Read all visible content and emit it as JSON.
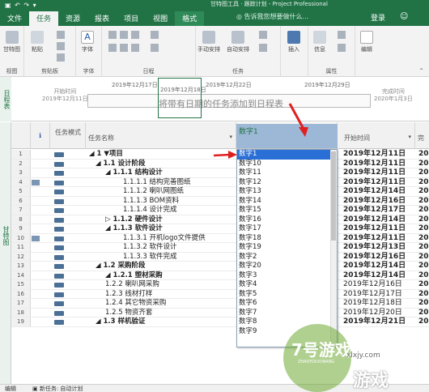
{
  "app": {
    "title": "甘特图工具 · 跟踪计划 - Project Professional",
    "tabs": [
      "文件",
      "任务",
      "资源",
      "报表",
      "项目",
      "视图",
      "格式"
    ],
    "active_tab": "任务",
    "search_placeholder": "告诉我您想要做什么...",
    "login_label": "登录",
    "accent": "#217346"
  },
  "ribbon": {
    "groups": [
      {
        "label": "视图",
        "buttons": [
          "甘特图"
        ]
      },
      {
        "label": "剪贴板",
        "buttons": [
          "粘贴"
        ]
      },
      {
        "label": "字体",
        "buttons": [
          "字体"
        ]
      },
      {
        "label": "日程",
        "buttons": []
      },
      {
        "label": "任务",
        "buttons": [
          "手动安排",
          "自动安排",
          "任务"
        ]
      },
      {
        "label": "插入",
        "buttons": [
          "插入"
        ]
      },
      {
        "label": "属性",
        "buttons": [
          "信息"
        ]
      },
      {
        "label": "编辑",
        "buttons": [
          "编辑"
        ]
      }
    ]
  },
  "timeline": {
    "side_label": "日程表",
    "start_label": "开始时间",
    "start_date": "2019年12月11日",
    "end_label": "完成时间",
    "end_date": "2020年1月3日",
    "dates": [
      "2019年12月17日",
      "2019年12月18日",
      "2019年12月22日",
      "2019年12月29日"
    ],
    "placeholder": "将带有日期的任务添加到日程表"
  },
  "grid": {
    "side_label": "甘特图",
    "headers": {
      "info": "ℹ",
      "mode": "任务模式",
      "name": "任务名称",
      "new_column": "数字1",
      "start": "开始时间",
      "finish": "完"
    },
    "rows": [
      {
        "num": "1",
        "name": "◢ 1 ▼项目",
        "level": 0,
        "bold": true,
        "start": "2019年12月11日",
        "next": "20",
        "start_bold": true,
        "info": false
      },
      {
        "num": "2",
        "name": "◢ 1.1 设计阶段",
        "level": 1,
        "bold": true,
        "start": "2019年12月11日",
        "next": "20",
        "start_bold": true,
        "info": false
      },
      {
        "num": "3",
        "name": "◢ 1.1.1 结构设计",
        "level": 2,
        "bold": true,
        "start": "2019年12月11日",
        "next": "20",
        "start_bold": true,
        "info": false
      },
      {
        "num": "4",
        "name": "1.1.1.1 结构完善图纸",
        "level": 3,
        "bold": false,
        "start": "2019年12月11日",
        "next": "20",
        "start_bold": true,
        "info": true
      },
      {
        "num": "5",
        "name": "1.1.1.2 喇叭网图纸",
        "level": 3,
        "bold": false,
        "start": "2019年12月14日",
        "next": "20",
        "start_bold": true,
        "info": false
      },
      {
        "num": "6",
        "name": "1.1.1.3 BOM资料",
        "level": 3,
        "bold": false,
        "start": "2019年12月16日",
        "next": "20",
        "start_bold": true,
        "info": false
      },
      {
        "num": "7",
        "name": "1.1.1.4 设计完成",
        "level": 3,
        "bold": false,
        "start": "2019年12月17日",
        "next": "20",
        "start_bold": true,
        "info": false
      },
      {
        "num": "8",
        "name": "▷ 1.1.2 硬件设计",
        "level": 2,
        "bold": true,
        "start": "2019年12月14日",
        "next": "20",
        "start_bold": true,
        "info": false
      },
      {
        "num": "9",
        "name": "◢ 1.1.3 软件设计",
        "level": 2,
        "bold": true,
        "start": "2019年12月11日",
        "next": "20",
        "start_bold": true,
        "info": false
      },
      {
        "num": "10",
        "name": "1.1.3.1 开机logo文件提供",
        "level": 3,
        "bold": false,
        "start": "2019年12月11日",
        "next": "20",
        "start_bold": true,
        "info": true
      },
      {
        "num": "11",
        "name": "1.1.3.2 软件设计",
        "level": 3,
        "bold": false,
        "start": "2019年12月13日",
        "next": "20",
        "start_bold": true,
        "info": false
      },
      {
        "num": "12",
        "name": "1.1.3.3 软件完成",
        "level": 3,
        "bold": false,
        "start": "2019年12月16日",
        "next": "20",
        "start_bold": true,
        "info": false
      },
      {
        "num": "13",
        "name": "◢ 1.2 采购阶段",
        "level": 1,
        "bold": true,
        "start": "2019年12月14日",
        "next": "20",
        "start_bold": true,
        "info": false
      },
      {
        "num": "14",
        "name": "◢ 1.2.1 塑材采购",
        "level": 2,
        "bold": true,
        "start": "2019年12月14日",
        "next": "20",
        "start_bold": true,
        "info": false
      },
      {
        "num": "15",
        "name": "1.2.2 喇叭网采购",
        "level": 2,
        "bold": false,
        "start": "2019年12月16日",
        "next": "20",
        "start_bold": false,
        "info": false
      },
      {
        "num": "16",
        "name": "1.2.3 线材打样",
        "level": 2,
        "bold": false,
        "start": "2019年12月17日",
        "next": "20",
        "start_bold": false,
        "info": false
      },
      {
        "num": "17",
        "name": "1.2.4 其它物资采购",
        "level": 2,
        "bold": false,
        "start": "2019年12月18日",
        "next": "20",
        "start_bold": false,
        "info": false
      },
      {
        "num": "18",
        "name": "1.2.5 物资齐套",
        "level": 2,
        "bold": false,
        "start": "2019年12月20日",
        "next": "20",
        "start_bold": false,
        "info": false
      },
      {
        "num": "19",
        "name": "◢ 1.3 样机验证",
        "level": 1,
        "bold": true,
        "start": "2019年12月21日",
        "next": "20",
        "start_bold": true,
        "info": false
      }
    ]
  },
  "dropdown": {
    "selected": "数字1",
    "items": [
      "数字1",
      "数字10",
      "数字11",
      "数字12",
      "数字13",
      "数字14",
      "数字15",
      "数字16",
      "数字17",
      "数字18",
      "数字19",
      "数字2",
      "数字20",
      "数字3",
      "数字4",
      "数字5",
      "数字6",
      "数字7",
      "数字8",
      "数字9"
    ]
  },
  "status_bar": {
    "mode": "编辑",
    "new_task": "新任务: 自动计划"
  },
  "watermark": {
    "brand": "7号游戏网",
    "pinyin": "ZHAOYOUXIWANG",
    "domain": "xlxjy.com",
    "big": "游戏"
  }
}
